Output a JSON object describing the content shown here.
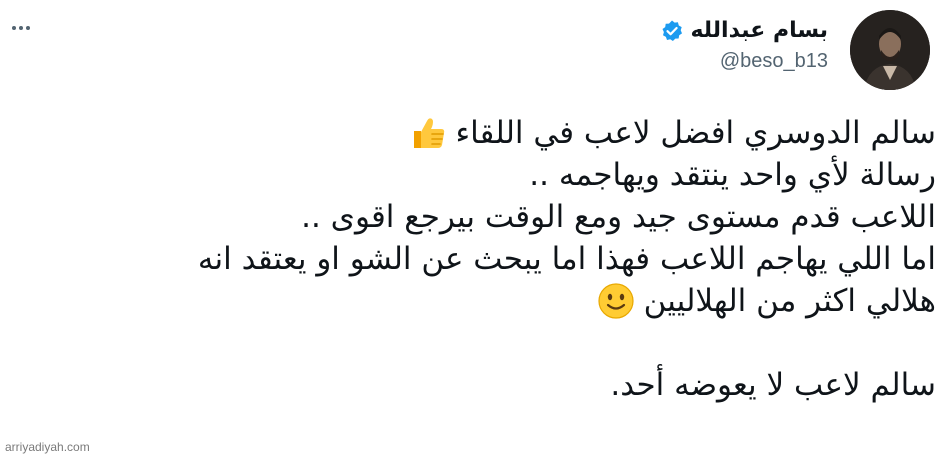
{
  "tweet": {
    "author": {
      "display_name": "بسام عبدالله",
      "handle": "@beso_b13",
      "verified": true,
      "verified_color": "#1d9bf0"
    },
    "lines": [
      {
        "text": "سالم الدوسري افضل لاعب في اللقاء",
        "emoji": "thumbs-up-emoji"
      },
      {
        "text": "رسالة لأي واحد ينتقد ويهاجمه ..",
        "emoji": null
      },
      {
        "text": "اللاعب قدم مستوى جيد ومع الوقت بيرجع اقوى ..",
        "emoji": null
      },
      {
        "text": "اما اللي يهاجم اللاعب فهذا اما يبحث عن الشو او يعتقد انه",
        "emoji": null
      },
      {
        "text": "هلالي اكثر من الهلاليين",
        "emoji": "slightly-smiling-face-emoji"
      },
      {
        "text": "",
        "emoji": null
      },
      {
        "text": "سالم لاعب لا يعوضه أحد.",
        "emoji": null
      }
    ]
  },
  "watermark": "arriyadiyah.com"
}
